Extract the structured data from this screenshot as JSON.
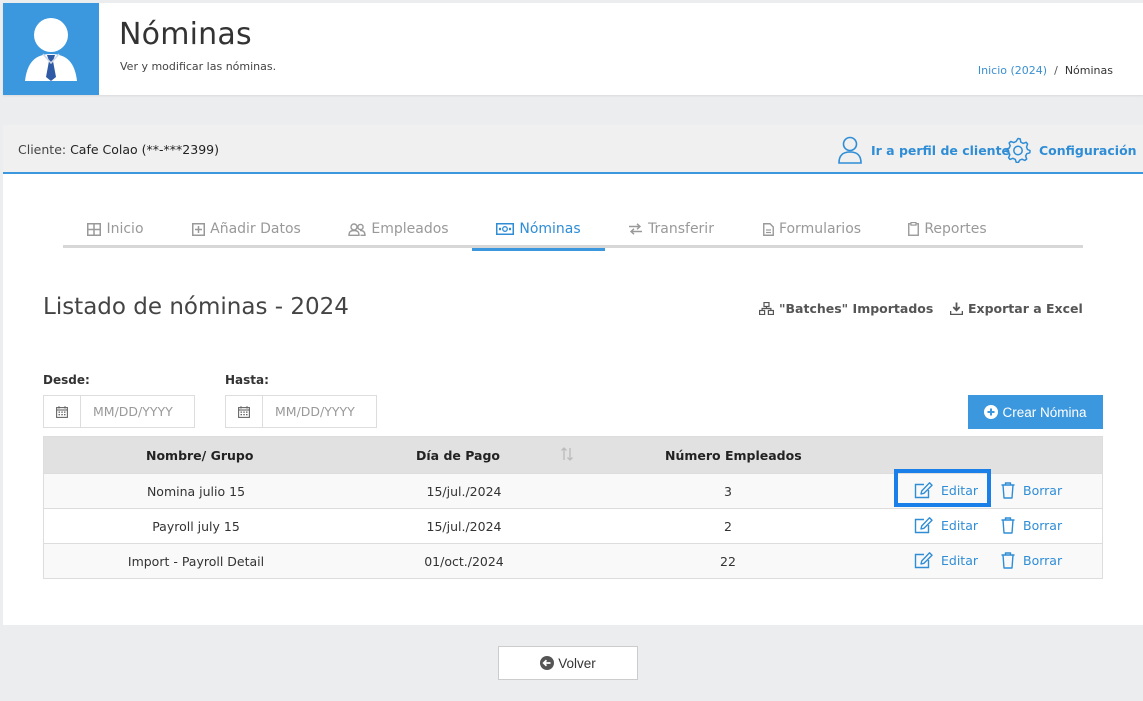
{
  "header": {
    "title": "Nóminas",
    "subtitle": "Ver y modificar las nóminas.",
    "breadcrumb": {
      "home": "Inicio (2024)",
      "separator": "/",
      "current": "Nóminas"
    },
    "avatar_bg": "#3b97de"
  },
  "client_bar": {
    "label": "Cliente:",
    "value": "Cafe Colao (**-***2399)",
    "profile_link": "Ir a perfil de cliente",
    "settings_link": "Configuración"
  },
  "tabs": [
    {
      "label": "Inicio",
      "icon": "table-icon"
    },
    {
      "label": "Añadir Datos",
      "icon": "plus-square-icon"
    },
    {
      "label": "Empleados",
      "icon": "users-icon"
    },
    {
      "label": "Nóminas",
      "icon": "money-bill-icon",
      "active": true
    },
    {
      "label": "Transferir",
      "icon": "exchange-icon"
    },
    {
      "label": "Formularios",
      "icon": "file-icon"
    },
    {
      "label": "Reportes",
      "icon": "clipboard-icon"
    }
  ],
  "main": {
    "title": "Listado de nóminas - 2024",
    "batches_link": "\"Batches\" Importados",
    "export_link": "Exportar a Excel",
    "from_label": "Desde:",
    "to_label": "Hasta:",
    "from_placeholder": "MM/DD/YYYY",
    "to_placeholder": "MM/DD/YYYY",
    "create_button": "Crear Nómina"
  },
  "table": {
    "headers": [
      "Nombre/ Grupo",
      "Día de Pago",
      "Número Empleados"
    ],
    "edit_label": "Editar",
    "delete_label": "Borrar",
    "rows": [
      {
        "name": "Nomina julio 15",
        "pay_date": "15/jul./2024",
        "employees": "3"
      },
      {
        "name": "Payroll july 15",
        "pay_date": "15/jul./2024",
        "employees": "2"
      },
      {
        "name": "Import - Payroll Detail",
        "pay_date": "01/oct./2024",
        "employees": "22"
      }
    ]
  },
  "footer": {
    "back_button": "Volver"
  },
  "colors": {
    "accent": "#3b97de",
    "link": "#2f8dd6",
    "highlight": "#1a7fe8"
  }
}
